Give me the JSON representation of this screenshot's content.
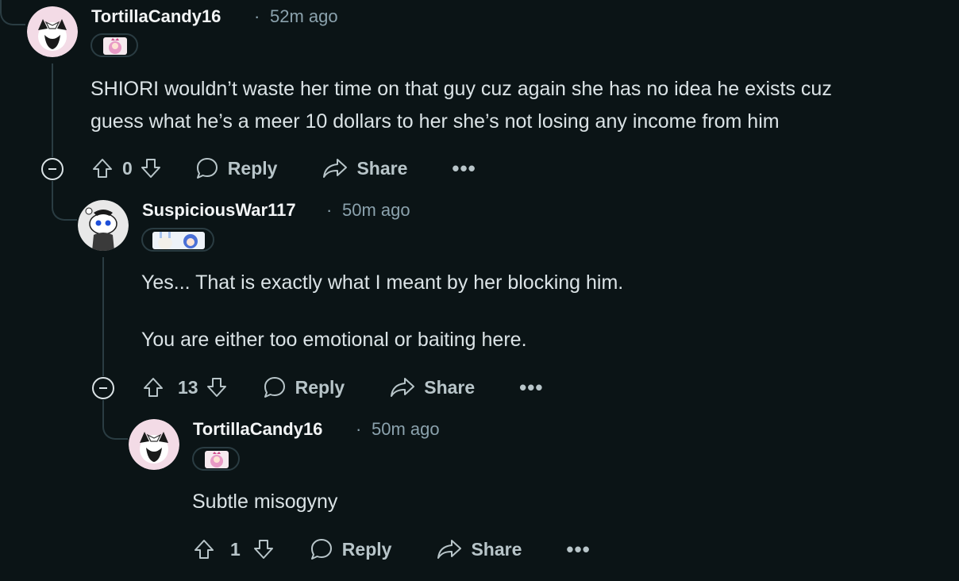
{
  "comments": [
    {
      "author": "TortillaCandy16",
      "time": "52m ago",
      "lines": [
        "SHIORI wouldn’t waste her time on that guy cuz again she has no idea he exists cuz",
        "guess what he’s a meer 10 dollars to her she’s not losing any income from him"
      ],
      "votes": "0",
      "reply_label": "Reply",
      "share_label": "Share",
      "more_label": "•••"
    },
    {
      "author": "SuspiciousWar117",
      "time": "50m ago",
      "lines": [
        "Yes... That is exactly what I meant by her blocking him.",
        "You are either too emotional or baiting here."
      ],
      "votes": "13",
      "reply_label": "Reply",
      "share_label": "Share",
      "more_label": "•••"
    },
    {
      "author": "TortillaCandy16",
      "time": "50m ago",
      "lines": [
        "Subtle misogyny"
      ],
      "votes": "1",
      "reply_label": "Reply",
      "share_label": "Share",
      "more_label": "•••"
    }
  ],
  "separator": "·",
  "colors": {
    "background": "#0b1416",
    "thread": "#2a3c42",
    "meta": "#8ba2ad",
    "text": "#dbe3e6"
  },
  "icons": [
    "collapse-icon",
    "upvote-icon",
    "downvote-icon",
    "reply-bubble-icon",
    "share-arrow-icon",
    "more-icon"
  ]
}
